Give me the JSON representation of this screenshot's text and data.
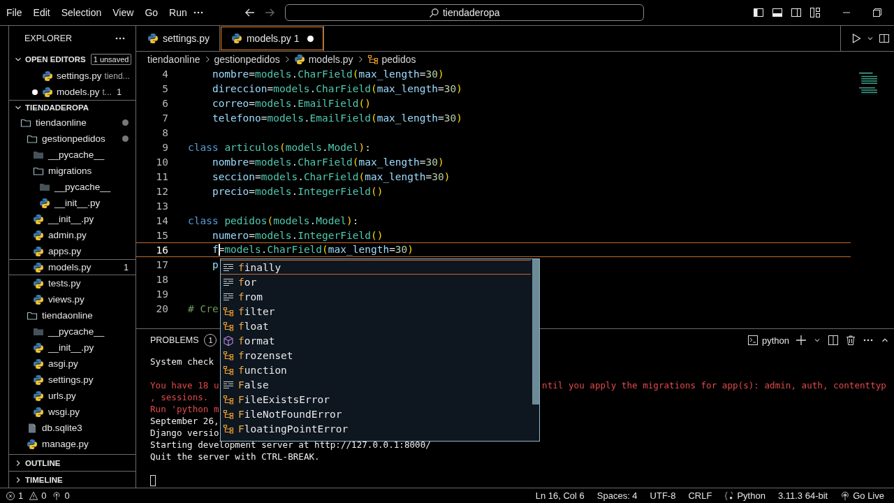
{
  "title_bar": {
    "menu": [
      "File",
      "Edit",
      "Selection",
      "View",
      "Go",
      "Run"
    ],
    "search": {
      "value": "tiendaderopa"
    }
  },
  "explorer": {
    "title": "EXPLORER",
    "open_editors": {
      "title": "OPEN EDITORS",
      "badge": "1 unsaved",
      "expanded": true,
      "items": [
        {
          "name": "settings.py",
          "description": "tiend...",
          "unsaved": false
        },
        {
          "name": "models.py",
          "description": "t...",
          "badge": "1",
          "unsaved": true
        }
      ]
    },
    "folder": {
      "title": "TIENDADEROPA",
      "expanded": true,
      "tree": [
        {
          "name": "tiendaonline",
          "kind": "folder",
          "modified": true,
          "selected": false,
          "children": [
            {
              "name": "gestionpedidos",
              "kind": "folder",
              "modified": true,
              "selected": false,
              "children": [
                {
                  "name": "__pycache__",
                  "kind": "cache",
                  "modified": false,
                  "selected": false
                },
                {
                  "name": "migrations",
                  "kind": "folder",
                  "modified": false,
                  "selected": false,
                  "children": [
                    {
                      "name": "__pycache__",
                      "kind": "cache",
                      "modified": false,
                      "selected": false
                    },
                    {
                      "name": "__init__.py",
                      "kind": "python",
                      "modified": false,
                      "selected": false
                    }
                  ]
                },
                {
                  "name": "__init__.py",
                  "kind": "python",
                  "modified": false,
                  "selected": false
                },
                {
                  "name": "admin.py",
                  "kind": "python",
                  "modified": false,
                  "selected": false
                },
                {
                  "name": "apps.py",
                  "kind": "python",
                  "modified": false,
                  "selected": false
                },
                {
                  "name": "models.py",
                  "kind": "python",
                  "badge": "1",
                  "modified": false,
                  "selected": true
                },
                {
                  "name": "tests.py",
                  "kind": "python",
                  "modified": false,
                  "selected": false
                },
                {
                  "name": "views.py",
                  "kind": "python",
                  "modified": false,
                  "selected": false
                }
              ]
            },
            {
              "name": "tiendaonline",
              "kind": "folder",
              "modified": false,
              "selected": false,
              "children": [
                {
                  "name": "__pycache__",
                  "kind": "cache",
                  "modified": false,
                  "selected": false
                },
                {
                  "name": "__init__.py",
                  "kind": "python",
                  "modified": false,
                  "selected": false
                },
                {
                  "name": "asgi.py",
                  "kind": "python",
                  "modified": false,
                  "selected": false
                },
                {
                  "name": "settings.py",
                  "kind": "python",
                  "modified": false,
                  "selected": false
                },
                {
                  "name": "urls.py",
                  "kind": "python",
                  "modified": false,
                  "selected": false
                },
                {
                  "name": "wsgi.py",
                  "kind": "python",
                  "modified": false,
                  "selected": false
                }
              ]
            },
            {
              "name": "db.sqlite3",
              "kind": "database",
              "modified": false,
              "selected": false
            },
            {
              "name": "manage.py",
              "kind": "python",
              "modified": false,
              "selected": false
            }
          ]
        }
      ]
    },
    "sections": [
      {
        "title": "OUTLINE",
        "expanded": false
      },
      {
        "title": "TIMELINE",
        "expanded": false
      }
    ]
  },
  "editor": {
    "tabs": [
      {
        "label": "settings.py",
        "unsaved": false,
        "selected": false
      },
      {
        "label": "models.py",
        "badge": "1",
        "unsaved": true,
        "selected": true
      }
    ],
    "breadcrumb": [
      {
        "label": "tiendaonline",
        "kind": "folder"
      },
      {
        "label": "gestionpedidos",
        "kind": "folder"
      },
      {
        "label": "models.py",
        "kind": "python"
      },
      {
        "label": "pedidos",
        "kind": "class"
      }
    ],
    "lines": [
      {
        "number": "4",
        "indented": true,
        "current": false,
        "tokens": [
          {
            "kind": "var",
            "text": "nombre"
          },
          {
            "kind": "plain",
            "text": "="
          },
          {
            "kind": "type",
            "text": "models"
          },
          {
            "kind": "plain",
            "text": "."
          },
          {
            "kind": "type",
            "text": "CharField"
          },
          {
            "kind": "bracket",
            "text": "("
          },
          {
            "kind": "var",
            "text": "max_length"
          },
          {
            "kind": "plain",
            "text": "="
          },
          {
            "kind": "number",
            "text": "30"
          },
          {
            "kind": "bracket",
            "text": ")"
          }
        ]
      },
      {
        "number": "5",
        "indented": true,
        "current": false,
        "tokens": [
          {
            "kind": "var",
            "text": "direccion"
          },
          {
            "kind": "plain",
            "text": "="
          },
          {
            "kind": "type",
            "text": "models"
          },
          {
            "kind": "plain",
            "text": "."
          },
          {
            "kind": "type",
            "text": "CharField"
          },
          {
            "kind": "bracket",
            "text": "("
          },
          {
            "kind": "var",
            "text": "max_length"
          },
          {
            "kind": "plain",
            "text": "="
          },
          {
            "kind": "number",
            "text": "30"
          },
          {
            "kind": "bracket",
            "text": ")"
          }
        ]
      },
      {
        "number": "6",
        "indented": true,
        "current": false,
        "tokens": [
          {
            "kind": "var",
            "text": "correo"
          },
          {
            "kind": "plain",
            "text": "="
          },
          {
            "kind": "type",
            "text": "models"
          },
          {
            "kind": "plain",
            "text": "."
          },
          {
            "kind": "type",
            "text": "EmailField"
          },
          {
            "kind": "bracket",
            "text": "()"
          }
        ]
      },
      {
        "number": "7",
        "indented": true,
        "current": false,
        "tokens": [
          {
            "kind": "var",
            "text": "telefono"
          },
          {
            "kind": "plain",
            "text": "="
          },
          {
            "kind": "type",
            "text": "models"
          },
          {
            "kind": "plain",
            "text": "."
          },
          {
            "kind": "type",
            "text": "EmailField"
          },
          {
            "kind": "bracket",
            "text": "("
          },
          {
            "kind": "var",
            "text": "max_length"
          },
          {
            "kind": "plain",
            "text": "="
          },
          {
            "kind": "number",
            "text": "30"
          },
          {
            "kind": "bracket",
            "text": ")"
          }
        ]
      },
      {
        "number": "8",
        "current": false
      },
      {
        "number": "9",
        "indented": false,
        "current": false,
        "tokens": [
          {
            "kind": "keyword",
            "text": "class"
          },
          {
            "kind": "type",
            "text": "articulos"
          },
          {
            "kind": "bracket",
            "text": "("
          },
          {
            "kind": "type",
            "text": "models"
          },
          {
            "kind": "plain",
            "text": "."
          },
          {
            "kind": "type",
            "text": "Model"
          },
          {
            "kind": "bracket",
            "text": ")"
          },
          {
            "kind": "plain",
            "text": ":"
          }
        ]
      },
      {
        "number": "10",
        "indented": true,
        "current": false,
        "tokens": [
          {
            "kind": "var",
            "text": "nombre"
          },
          {
            "kind": "plain",
            "text": "="
          },
          {
            "kind": "type",
            "text": "models"
          },
          {
            "kind": "plain",
            "text": "."
          },
          {
            "kind": "type",
            "text": "CharField"
          },
          {
            "kind": "bracket",
            "text": "("
          },
          {
            "kind": "var",
            "text": "max_length"
          },
          {
            "kind": "plain",
            "text": "="
          },
          {
            "kind": "number",
            "text": "30"
          },
          {
            "kind": "bracket",
            "text": ")"
          }
        ]
      },
      {
        "number": "11",
        "indented": true,
        "current": false,
        "tokens": [
          {
            "kind": "var",
            "text": "seccion"
          },
          {
            "kind": "plain",
            "text": "="
          },
          {
            "kind": "type",
            "text": "models"
          },
          {
            "kind": "plain",
            "text": "."
          },
          {
            "kind": "type",
            "text": "CharField"
          },
          {
            "kind": "bracket",
            "text": "("
          },
          {
            "kind": "var",
            "text": "max_length"
          },
          {
            "kind": "plain",
            "text": "="
          },
          {
            "kind": "number",
            "text": "30"
          },
          {
            "kind": "bracket",
            "text": ")"
          }
        ]
      },
      {
        "number": "12",
        "indented": true,
        "current": false,
        "tokens": [
          {
            "kind": "var",
            "text": "precio"
          },
          {
            "kind": "plain",
            "text": "="
          },
          {
            "kind": "type",
            "text": "models"
          },
          {
            "kind": "plain",
            "text": "."
          },
          {
            "kind": "type",
            "text": "IntegerField"
          },
          {
            "kind": "bracket",
            "text": "()"
          }
        ]
      },
      {
        "number": "13",
        "current": false
      },
      {
        "number": "14",
        "indented": false,
        "current": false,
        "tokens": [
          {
            "kind": "keyword",
            "text": "class"
          },
          {
            "kind": "type",
            "text": "pedidos"
          },
          {
            "kind": "bracket",
            "text": "("
          },
          {
            "kind": "type",
            "text": "models"
          },
          {
            "kind": "plain",
            "text": "."
          },
          {
            "kind": "type",
            "text": "Model"
          },
          {
            "kind": "bracket",
            "text": ")"
          },
          {
            "kind": "plain",
            "text": ":"
          }
        ]
      },
      {
        "number": "15",
        "indented": true,
        "current": false,
        "tokens": [
          {
            "kind": "var",
            "text": "numero"
          },
          {
            "kind": "plain",
            "text": "="
          },
          {
            "kind": "type",
            "text": "models"
          },
          {
            "kind": "plain",
            "text": "."
          },
          {
            "kind": "type",
            "text": "IntegerField"
          },
          {
            "kind": "bracket",
            "text": "()"
          }
        ]
      },
      {
        "number": "16",
        "indented": true,
        "current": true,
        "tokens": [
          {
            "kind": "var",
            "text": "f",
            "cursor": true
          },
          {
            "kind": "plain",
            "text": "="
          },
          {
            "kind": "type",
            "text": "models"
          },
          {
            "kind": "plain",
            "text": "."
          },
          {
            "kind": "type",
            "text": "CharField"
          },
          {
            "kind": "bracket",
            "text": "("
          },
          {
            "kind": "var",
            "text": "max_length"
          },
          {
            "kind": "plain",
            "text": "="
          },
          {
            "kind": "number",
            "text": "30"
          },
          {
            "kind": "bracket",
            "text": ")"
          }
        ]
      },
      {
        "number": "17",
        "indented": true,
        "current": false,
        "tokens": [
          {
            "kind": "var",
            "text": "p"
          }
        ]
      },
      {
        "number": "18",
        "current": false
      },
      {
        "number": "19",
        "current": false
      },
      {
        "number": "20",
        "indented": false,
        "current": false,
        "tokens": [
          {
            "kind": "comment",
            "text": "# Cre"
          }
        ]
      }
    ]
  },
  "suggestions": [
    {
      "label": "finally",
      "kind": "keyword",
      "selected": true
    },
    {
      "label": "for",
      "kind": "keyword",
      "selected": false
    },
    {
      "label": "from",
      "kind": "keyword",
      "selected": false
    },
    {
      "label": "filter",
      "kind": "class",
      "selected": false
    },
    {
      "label": "float",
      "kind": "class",
      "selected": false
    },
    {
      "label": "format",
      "kind": "method",
      "selected": false
    },
    {
      "label": "frozenset",
      "kind": "class",
      "selected": false
    },
    {
      "label": "function",
      "kind": "class",
      "selected": false
    },
    {
      "label": "False",
      "kind": "keyword",
      "selected": false
    },
    {
      "label": "FileExistsError",
      "kind": "class",
      "selected": false
    },
    {
      "label": "FileNotFoundError",
      "kind": "class",
      "selected": false
    },
    {
      "label": "FloatingPointError",
      "kind": "class",
      "selected": false
    }
  ],
  "panel": {
    "tab": {
      "label": "PROBLEMS",
      "badge": "1"
    },
    "terminal_name": "python",
    "lines": [
      {
        "kind": "normal",
        "text": "System check"
      },
      {
        "kind": "blank"
      },
      {
        "kind": "error",
        "text": "You have 18 u",
        "right": "ntil you apply the migrations for app(s): admin, auth, contenttyp"
      },
      {
        "kind": "error",
        "text": ", sessions."
      },
      {
        "kind": "error",
        "text": "Run 'python m"
      },
      {
        "kind": "normal",
        "text": "September 26,"
      },
      {
        "kind": "normal",
        "text": "Django versio"
      },
      {
        "kind": "normal",
        "text": "Starting development server at http://127.0.0.1:8000/"
      },
      {
        "kind": "normal",
        "text": "Quit the server with CTRL-BREAK."
      },
      {
        "kind": "blank"
      },
      {
        "kind": "cursor"
      }
    ]
  },
  "status_bar": {
    "left": [
      {
        "kind": "errors",
        "text": "1"
      },
      {
        "kind": "warnings",
        "text": "0"
      },
      {
        "kind": "ports",
        "text": "0"
      }
    ],
    "right": [
      {
        "kind": "text",
        "text": "Ln 16, Col 6"
      },
      {
        "kind": "text",
        "text": "Spaces: 4"
      },
      {
        "kind": "text",
        "text": "UTF-8"
      },
      {
        "kind": "text",
        "text": "CRLF"
      },
      {
        "kind": "language",
        "text": "Python"
      },
      {
        "kind": "text",
        "text": "3.11.3 64-bit"
      },
      {
        "kind": "live",
        "text": "Go Live"
      }
    ]
  }
}
